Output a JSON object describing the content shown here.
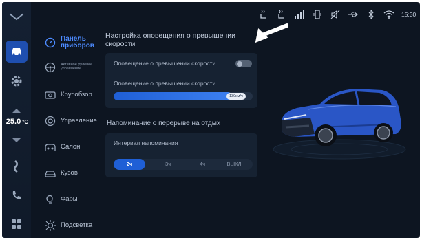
{
  "status_bar": {
    "time": "15:30",
    "icons": [
      "seat-heat-driver-icon",
      "seat-heat-passenger-icon",
      "signal-icon",
      "phone-link-icon",
      "mute-icon",
      "usb-icon",
      "bluetooth-icon",
      "wifi-icon"
    ]
  },
  "left_rail": {
    "temperature": "25.0",
    "temperature_unit": "°C"
  },
  "menu": {
    "items": [
      {
        "label": "Панель приборов",
        "icon": "gauge-icon",
        "active": true
      },
      {
        "label": "Активное рулевое управление",
        "icon": "steering-wheel-icon",
        "active": false
      },
      {
        "label": "Круг.обзор",
        "icon": "camera-icon",
        "active": false
      },
      {
        "label": "Управление",
        "icon": "control-icon",
        "active": false
      },
      {
        "label": "Салон",
        "icon": "cabin-icon",
        "active": false
      },
      {
        "label": "Кузов",
        "icon": "car-body-icon",
        "active": false
      },
      {
        "label": "Фары",
        "icon": "headlight-icon",
        "active": false
      },
      {
        "label": "Подсветка",
        "icon": "ambient-light-icon",
        "active": false
      }
    ]
  },
  "content": {
    "title": "Настройка оповещения о превышении скорости",
    "speed_alert_label": "Оповещение о превышении скорости",
    "speed_alert_enabled": false,
    "speed_alert_value_label": "Оповещение о превышении скорости",
    "speed_value": "130км/ч",
    "speed_fill_fraction": 0.85,
    "rest_title": "Напоминание о перерыве на отдых",
    "interval_label": "Интервал напоминания",
    "interval_options": [
      "2ч",
      "3ч",
      "4ч",
      "ВЫКЛ"
    ],
    "interval_selected": "2ч"
  },
  "colors": {
    "accent": "#1f5fd6",
    "background": "#0d1521",
    "card": "#162232",
    "car_body": "#2a56c6"
  }
}
